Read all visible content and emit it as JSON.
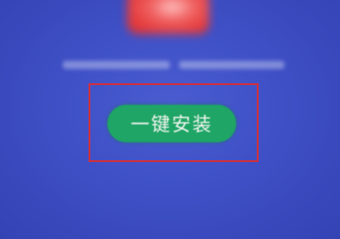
{
  "install_button": {
    "label": "一键安装"
  }
}
